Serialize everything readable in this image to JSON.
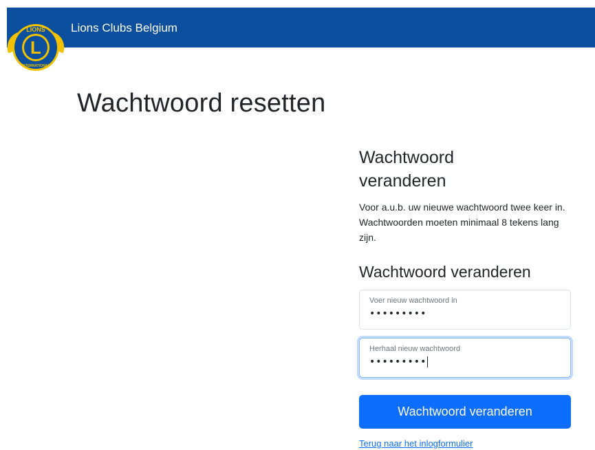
{
  "header": {
    "brand_title": "Lions Clubs Belgium",
    "logo": {
      "icon": "lions-logo-icon",
      "colors": {
        "gold": "#f2c200",
        "blue": "#0b4f9e",
        "white": "#ffffff"
      },
      "letter": "L",
      "top_word": "LIONS",
      "bottom_word": "INTERNATIONAL"
    },
    "band_color": "#0b4f9e"
  },
  "page": {
    "title": "Wachtwoord resetten"
  },
  "panel": {
    "title": "Wachtwoord veranderen",
    "description": "Voor a.u.b. uw nieuwe wachtwoord twee keer in. Wachtwoorden moeten minimaal 8 tekens lang zijn.",
    "form_heading": "Wachtwoord veranderen",
    "new_password": {
      "label": "Voer nieuw wachtwoord in",
      "value": "•••••••••"
    },
    "repeat_password": {
      "label": "Herhaal nieuw wachtwoord",
      "value": "•••••••••"
    },
    "submit_label": "Wachtwoord veranderen",
    "back_link": "Terug naar het inlogformulier"
  },
  "colors": {
    "primary": "#0d6efd",
    "focus_border": "#86b7fe",
    "text": "#212529"
  }
}
